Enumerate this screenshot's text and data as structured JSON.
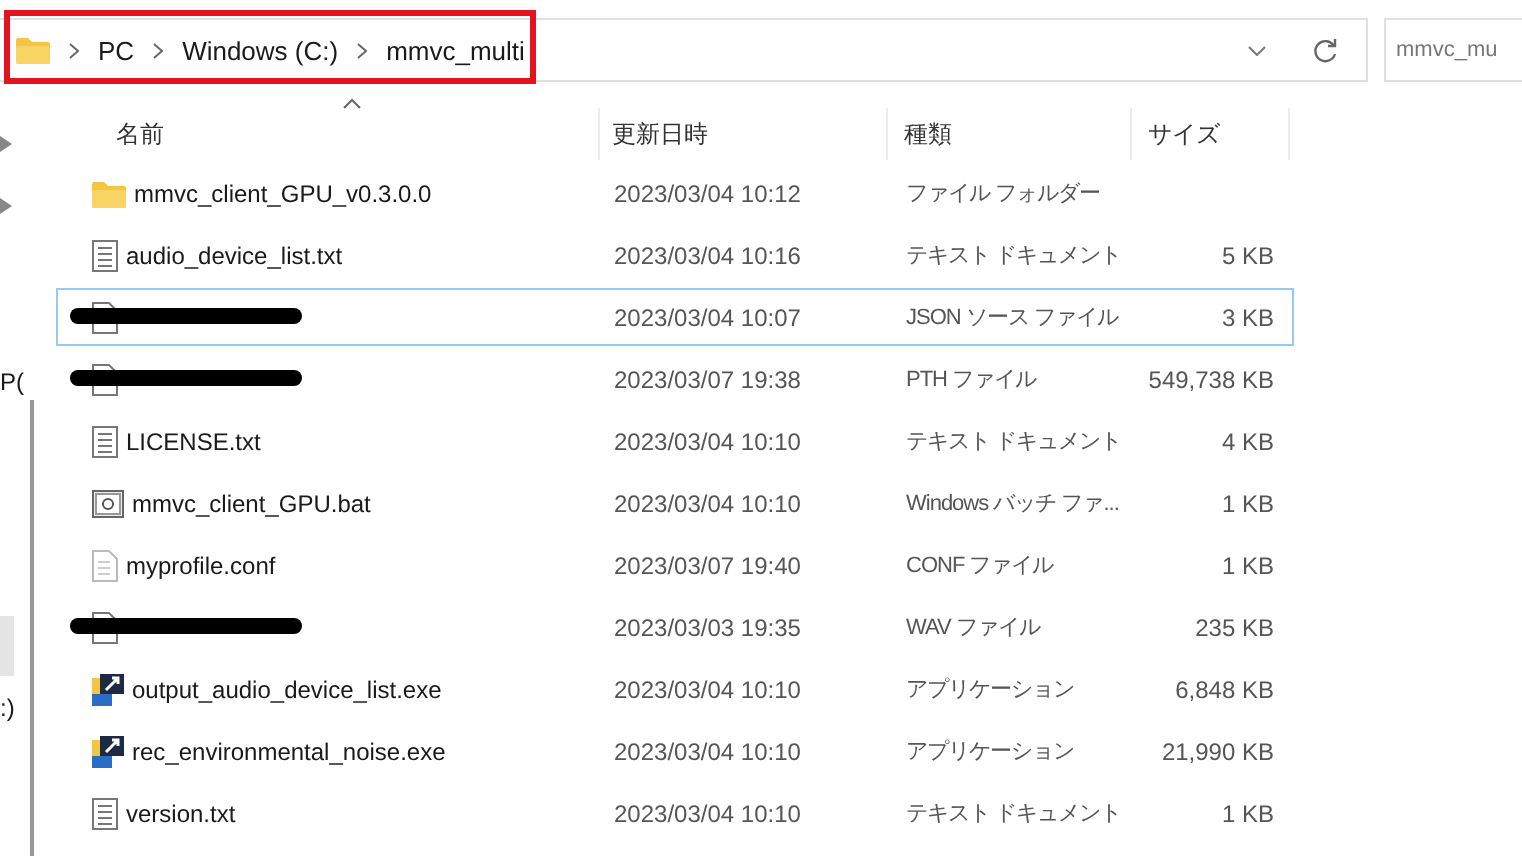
{
  "address_bar": {
    "crumbs": [
      "PC",
      "Windows (C:)",
      "mmvc_multi"
    ]
  },
  "search": {
    "value": "mmvc_mu"
  },
  "sidebar": {
    "fragments": [
      "P(",
      ":)"
    ]
  },
  "table": {
    "columns": [
      "名前",
      "更新日時",
      "種類",
      "サイズ"
    ],
    "rows": [
      {
        "kind": "folder",
        "name": "mmvc_client_GPU_v0.3.0.0",
        "date": "2023/03/04 10:12",
        "type": "ファイル フォルダー",
        "size": "",
        "selected": false,
        "redacted": false
      },
      {
        "kind": "text",
        "name": "audio_device_list.txt",
        "date": "2023/03/04 10:16",
        "type": "テキスト ドキュメント",
        "size": "5 KB",
        "selected": false,
        "redacted": false
      },
      {
        "kind": "file",
        "name": "",
        "date": "2023/03/04 10:07",
        "type": "JSON ソース ファイル",
        "size": "3 KB",
        "selected": true,
        "redacted": true
      },
      {
        "kind": "file",
        "name": "",
        "date": "2023/03/07 19:38",
        "type": "PTH ファイル",
        "size": "549,738 KB",
        "selected": false,
        "redacted": true
      },
      {
        "kind": "text",
        "name": "LICENSE.txt",
        "date": "2023/03/04 10:10",
        "type": "テキスト ドキュメント",
        "size": "4 KB",
        "selected": false,
        "redacted": false
      },
      {
        "kind": "bat",
        "name": "mmvc_client_GPU.bat",
        "date": "2023/03/04 10:10",
        "type": "Windows バッチ ファ...",
        "size": "1 KB",
        "selected": false,
        "redacted": false
      },
      {
        "kind": "conf",
        "name": "myprofile.conf",
        "date": "2023/03/07 19:40",
        "type": "CONF ファイル",
        "size": "1 KB",
        "selected": false,
        "redacted": false
      },
      {
        "kind": "file",
        "name": "",
        "date": "2023/03/03 19:35",
        "type": "WAV ファイル",
        "size": "235 KB",
        "selected": false,
        "redacted": true
      },
      {
        "kind": "exe",
        "name": "output_audio_device_list.exe",
        "date": "2023/03/04 10:10",
        "type": "アプリケーション",
        "size": "6,848 KB",
        "selected": false,
        "redacted": false
      },
      {
        "kind": "exe",
        "name": "rec_environmental_noise.exe",
        "date": "2023/03/04 10:10",
        "type": "アプリケーション",
        "size": "21,990 KB",
        "selected": false,
        "redacted": false
      },
      {
        "kind": "text",
        "name": "version.txt",
        "date": "2023/03/04 10:10",
        "type": "テキスト ドキュメント",
        "size": "1 KB",
        "selected": false,
        "redacted": false
      }
    ]
  }
}
